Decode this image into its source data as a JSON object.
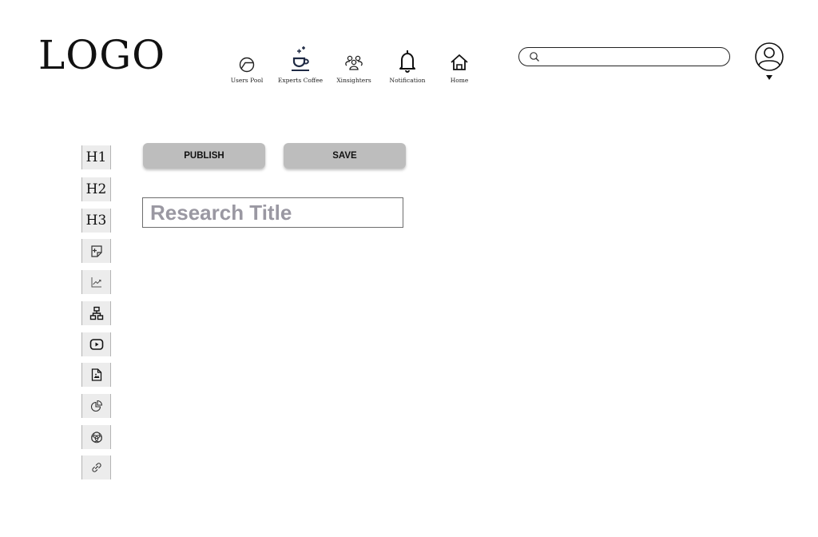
{
  "header": {
    "logo": "LOGO",
    "nav": [
      {
        "label": "Users Pool",
        "icon": "users-pool-icon"
      },
      {
        "label": "Experts Coffee",
        "icon": "coffee-icon"
      },
      {
        "label": "Xinsighters",
        "icon": "group-icon"
      },
      {
        "label": "Notification",
        "icon": "bell-icon"
      },
      {
        "label": "Home",
        "icon": "home-icon"
      }
    ],
    "search": {
      "value": "",
      "placeholder": "",
      "icon": "search-icon"
    },
    "profile": {
      "icon": "user-avatar-icon",
      "menu_icon": "caret-down-icon"
    },
    "colors": {
      "coffee_icon": "#1f2a44"
    }
  },
  "toolbar": {
    "items": [
      {
        "label": "H1",
        "icon": "heading-1"
      },
      {
        "label": "H2",
        "icon": "heading-2"
      },
      {
        "label": "H3",
        "icon": "heading-3"
      },
      {
        "label": "",
        "icon": "add-note-icon"
      },
      {
        "label": "",
        "icon": "line-chart-icon"
      },
      {
        "label": "",
        "icon": "hierarchy-icon"
      },
      {
        "label": "",
        "icon": "video-icon"
      },
      {
        "label": "",
        "icon": "image-file-icon"
      },
      {
        "label": "",
        "icon": "pie-chart-icon"
      },
      {
        "label": "",
        "icon": "venn-diagram-icon"
      },
      {
        "label": "",
        "icon": "link-icon"
      }
    ]
  },
  "actions": {
    "publish_label": "PUBLISH",
    "save_label": "SAVE",
    "button_color": "#bdbdbd"
  },
  "editor": {
    "title": {
      "value": "",
      "placeholder": "Research Title"
    }
  }
}
